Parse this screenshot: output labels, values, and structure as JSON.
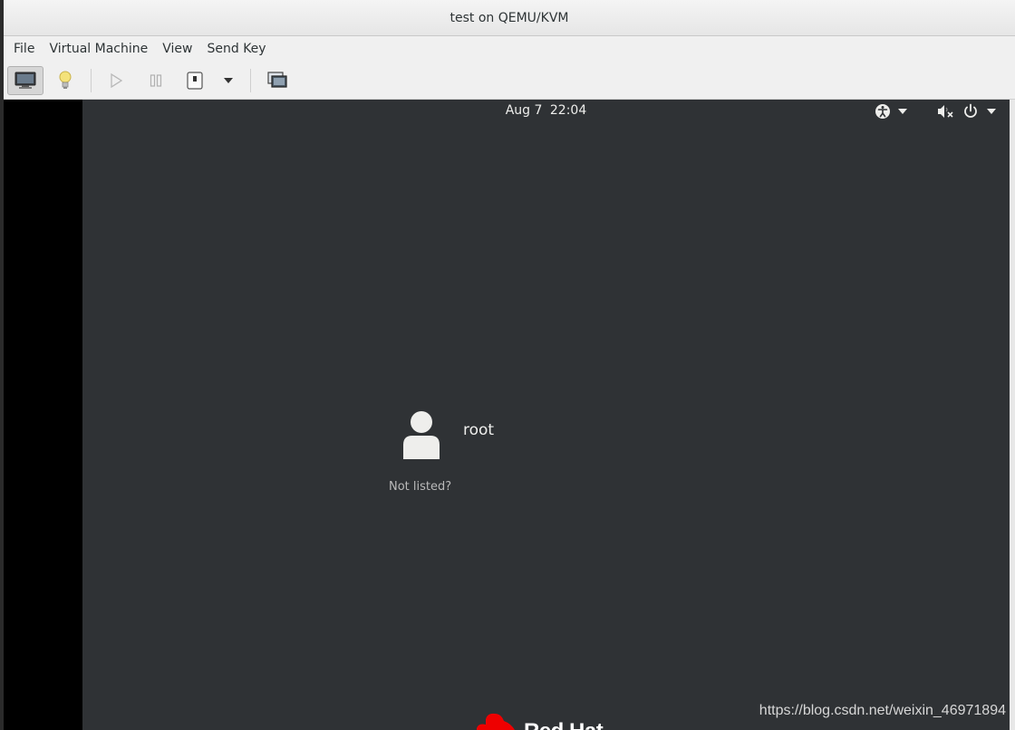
{
  "window": {
    "title": "test on QEMU/KVM"
  },
  "menubar": {
    "items": [
      "File",
      "Virtual Machine",
      "View",
      "Send Key"
    ]
  },
  "toolbar": {
    "buttons": [
      {
        "icon": "monitor-icon",
        "state": "pressed"
      },
      {
        "icon": "lightbulb-icon"
      },
      {
        "icon": "play-icon",
        "state": "disabled"
      },
      {
        "icon": "pause-icon",
        "state": "disabled"
      },
      {
        "icon": "power-icon"
      },
      {
        "icon": "chevron-down-icon"
      },
      {
        "icon": "fullscreen-icon"
      }
    ]
  },
  "guest": {
    "clock": {
      "date": "Aug 7",
      "time": "22:04"
    },
    "tray": [
      "accessibility-icon",
      "chevron-down-icon",
      "volume-muted-icon",
      "power-icon",
      "chevron-down-icon"
    ],
    "user": {
      "name": "root"
    },
    "not_listed": "Not listed?",
    "brand": "Red Hat",
    "colors": {
      "background": "#2f3235",
      "brand_red": "#ee0000"
    }
  },
  "watermark": "https://blog.csdn.net/weixin_46971894"
}
